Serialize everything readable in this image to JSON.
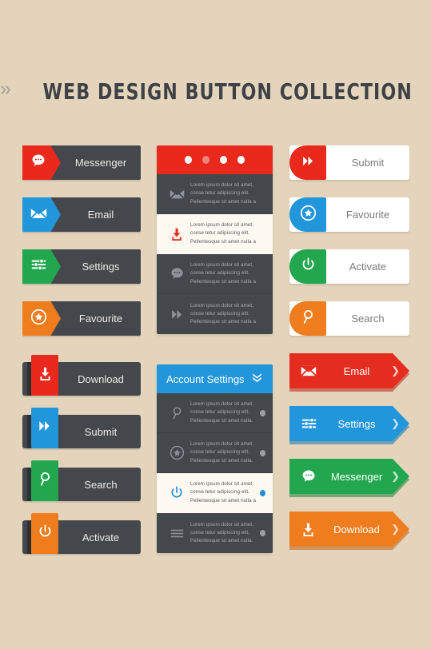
{
  "page": {
    "background_color": "#e3d4bb",
    "title": "WEB DESIGN BUTTON COLLECTION",
    "title_left_decoration": "»",
    "title_right_decoration": "«",
    "title_color": "#3e4247"
  },
  "colors": {
    "red": "#e8291c",
    "blue": "#2196da",
    "green": "#22a74f",
    "orange": "#ef7d1d",
    "dark": "#44484d",
    "white": "#ffffff",
    "cream": "#fdf8f0",
    "muted_text": "#a8adb2"
  },
  "lorem": {
    "line1": "Lorem ipsum dolor sit amet,",
    "line2": "conse tetur adipiscing elit.",
    "line3": "Pellentesque sit amet nulla a",
    "line3_short": "Pellentesque sit amet nulla."
  },
  "left_group_pentagon": {
    "name": "pentagon-tab-buttons",
    "items": [
      {
        "label": "Messenger",
        "color": "#e8291c",
        "icon": "chat-bubble-icon"
      },
      {
        "label": "Email",
        "color": "#2196da",
        "icon": "envelope-icon"
      },
      {
        "label": "Settings",
        "color": "#22a74f",
        "icon": "sliders-icon"
      },
      {
        "label": "Favourite",
        "color": "#ef7d1d",
        "icon": "star-badge-icon"
      }
    ]
  },
  "left_group_ribbon": {
    "name": "ribbon-tab-buttons",
    "items": [
      {
        "label": "Download",
        "color": "#e8291c",
        "icon": "download-icon"
      },
      {
        "label": "Submit",
        "color": "#2196da",
        "icon": "double-chevron-right-icon"
      },
      {
        "label": "Search",
        "color": "#22a74f",
        "icon": "magnifier-icon"
      },
      {
        "label": "Activate",
        "color": "#ef7d1d",
        "icon": "power-icon"
      }
    ]
  },
  "right_group_white": {
    "name": "white-body-buttons",
    "items": [
      {
        "label": "Submit",
        "color": "#e8291c",
        "icon": "double-chevron-right-icon"
      },
      {
        "label": "Favourite",
        "color": "#2196da",
        "icon": "star-badge-icon"
      },
      {
        "label": "Activate",
        "color": "#22a74f",
        "icon": "power-icon"
      },
      {
        "label": "Search",
        "color": "#ef7d1d",
        "icon": "magnifier-icon"
      }
    ]
  },
  "right_group_arrow": {
    "name": "arrow-buttons",
    "tip_glyph": "❯",
    "items": [
      {
        "label": "Email",
        "color": "#e42d1e",
        "shadow": "#b8241a",
        "icon": "envelope-icon"
      },
      {
        "label": "Settings",
        "color": "#2196da",
        "shadow": "#1a74ab",
        "icon": "sliders-icon"
      },
      {
        "label": "Messenger",
        "color": "#22a74f",
        "shadow": "#1a8440",
        "icon": "chat-bubble-icon"
      },
      {
        "label": "Download",
        "color": "#ef7d1d",
        "shadow": "#c06117",
        "icon": "download-icon"
      }
    ]
  },
  "panel_dots": {
    "name": "dots-header-panel",
    "header_color": "#e8291c",
    "dots": [
      {
        "state": "on"
      },
      {
        "state": "dim"
      },
      {
        "state": "on"
      },
      {
        "state": "on"
      }
    ],
    "rows": [
      {
        "icon": "envelope-icon",
        "active": false
      },
      {
        "icon": "download-icon",
        "active": true
      },
      {
        "icon": "chat-bubble-icon",
        "active": false
      },
      {
        "icon": "double-chevron-right-icon",
        "active": false
      }
    ]
  },
  "panel_account": {
    "name": "account-settings-panel",
    "header_color": "#2196da",
    "title": "Account Settings",
    "header_icon": "double-chevron-down-icon",
    "rows": [
      {
        "icon": "magnifier-icon",
        "active": false
      },
      {
        "icon": "star-badge-icon",
        "active": false
      },
      {
        "icon": "power-icon",
        "active": true
      },
      {
        "icon": "hamburger-icon",
        "active": false
      }
    ]
  }
}
